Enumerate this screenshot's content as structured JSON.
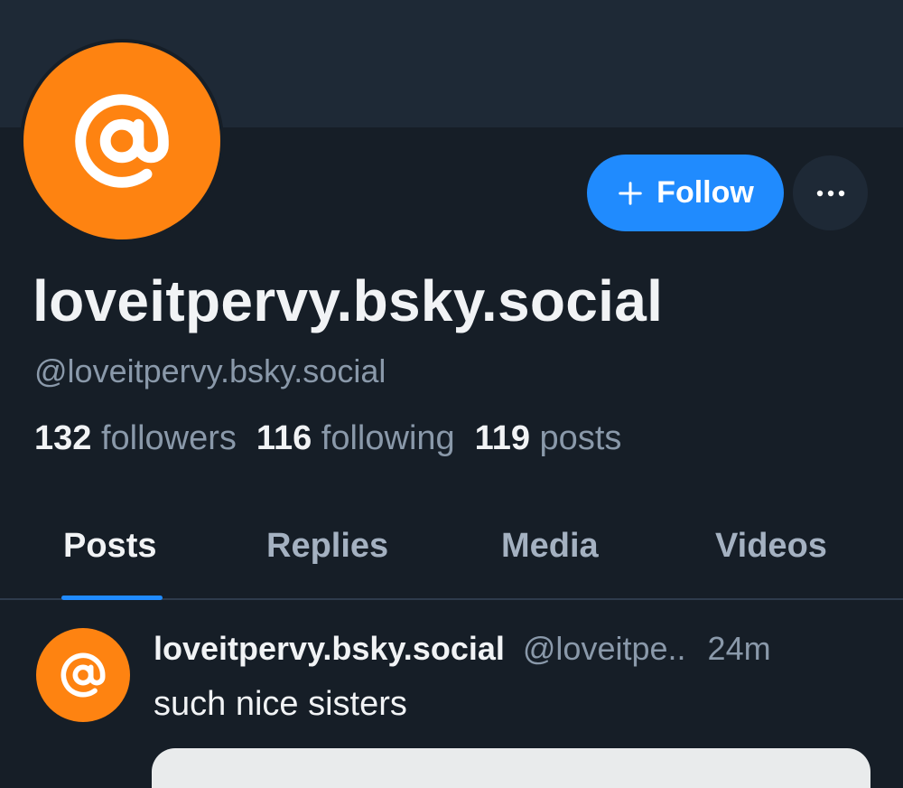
{
  "colors": {
    "background": "#161e27",
    "banner": "#1e2936",
    "avatar": "#fe8311",
    "accent": "#208bfe",
    "text_primary": "#f1f3f5",
    "text_secondary": "#8a99aa"
  },
  "profile": {
    "avatar_icon": "at-sign-icon",
    "display_name": "loveitpervy.bsky.social",
    "handle": "@loveitpervy.bsky.social",
    "stats": [
      {
        "count": "132",
        "label": "followers"
      },
      {
        "count": "116",
        "label": "following"
      },
      {
        "count": "119",
        "label": "posts"
      }
    ]
  },
  "actions": {
    "follow_icon": "plus-icon",
    "follow_label": "Follow",
    "more_icon": "ellipsis-icon"
  },
  "tabs": [
    {
      "label": "Posts",
      "active": true
    },
    {
      "label": "Replies",
      "active": false
    },
    {
      "label": "Media",
      "active": false
    },
    {
      "label": "Videos",
      "active": false
    }
  ],
  "post": {
    "author": "loveitpervy.bsky.social",
    "handle": "@loveitpe..",
    "time": "24m",
    "text": "such nice sisters"
  }
}
